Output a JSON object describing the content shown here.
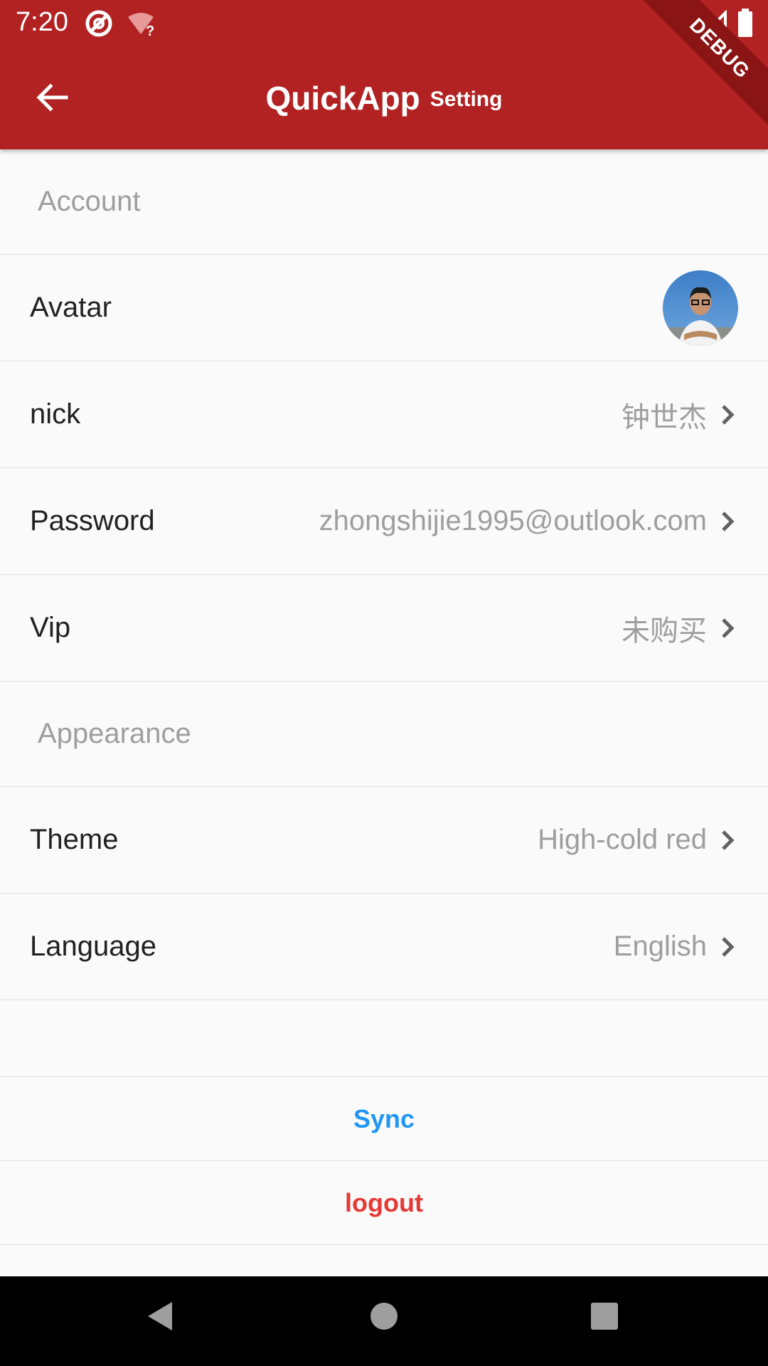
{
  "status_bar": {
    "time": "7:20",
    "icons": [
      "no-data-icon",
      "wifi-unknown-icon",
      "wifi-off-icon",
      "signal-icon",
      "battery-icon"
    ]
  },
  "appbar": {
    "title": "QuickApp",
    "subtitle": "Setting",
    "back_icon": "arrow-left-icon",
    "debug_label": "DEBUG",
    "color": "#b22222"
  },
  "sections": {
    "account": {
      "header": "Account",
      "rows": [
        {
          "label": "Avatar",
          "value": ""
        },
        {
          "label": "nick",
          "value": "钟世杰"
        },
        {
          "label": "Password",
          "value": "zhongshijie1995@outlook.com"
        },
        {
          "label": "Vip",
          "value": "未购买"
        }
      ]
    },
    "appearance": {
      "header": "Appearance",
      "rows": [
        {
          "label": "Theme",
          "value": "High-cold red"
        },
        {
          "label": "Language",
          "value": "English"
        }
      ]
    }
  },
  "actions": {
    "sync": {
      "label": "Sync",
      "color": "#2196f3"
    },
    "logout": {
      "label": "logout",
      "color": "#e53935"
    }
  },
  "nav_bar": {
    "icons": [
      "back-triangle-icon",
      "home-circle-icon",
      "recents-square-icon"
    ]
  }
}
